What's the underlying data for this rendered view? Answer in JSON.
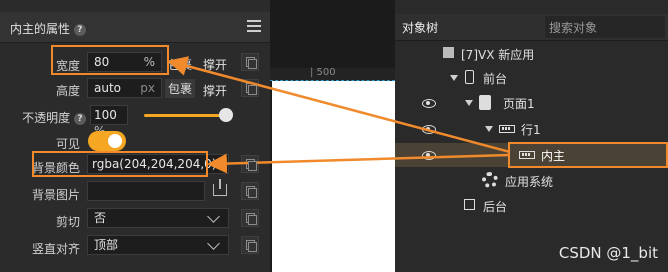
{
  "left_panel": {
    "title": "内主的属性",
    "help": "?",
    "width": {
      "label": "宽度",
      "value": "80",
      "unit": "%",
      "wrap": "包裹",
      "stretch": "撑开"
    },
    "height": {
      "label": "高度",
      "value": "auto",
      "unit": "px",
      "wrap": "包裹",
      "stretch": "撑开"
    },
    "opacity": {
      "label": "不透明度",
      "value": "100",
      "unit": "%",
      "level": 1.0
    },
    "visible": {
      "label": "可见",
      "on": true
    },
    "bg_color": {
      "label": "背景颜色",
      "value": "rgba(204,204,204,0)"
    },
    "bg_image": {
      "label": "背景图片",
      "value": ""
    },
    "clip": {
      "label": "剪切",
      "value": "否"
    },
    "valign": {
      "label": "竖直对齐",
      "value": "顶部"
    }
  },
  "canvas": {
    "ruler_label": "| 500"
  },
  "right_panel": {
    "tab": "对象树",
    "search_placeholder": "搜索对象",
    "tree": [
      {
        "label": "[7]VX 新应用"
      },
      {
        "label": "前台"
      },
      {
        "label": "页面1"
      },
      {
        "label": "行1"
      },
      {
        "label": "内主"
      },
      {
        "label": "应用系统"
      },
      {
        "label": "后台"
      }
    ]
  },
  "watermark": "CSDN @1_bit",
  "colors": {
    "accent": "#f08a2c",
    "toggle": "#f5a623",
    "selected_row": "#4a4234"
  }
}
